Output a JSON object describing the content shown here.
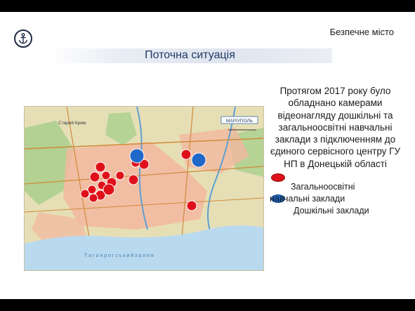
{
  "header": {
    "brand": "Безпечне місто",
    "title": "Поточна ситуація"
  },
  "logo_icon": "anchor-icon",
  "description": "Протягом 2017 року було обладнано камерами відеонагляду дошкільні та загальноосвітні навчальні заклади з підключенням до єдиного сервісного центру ГУ НП в Донецькій області",
  "legend": {
    "items": [
      {
        "label": "Загальноосвітні",
        "color": "#e0101b"
      },
      {
        "label": "навчальні  заклади",
        "color": "#1f67c8"
      },
      {
        "label": "Дошкільні заклади"
      }
    ]
  },
  "map": {
    "city_label": "МАРІУПОЛЬ",
    "sea_label": "Т а г а н р о г с ь к и й   з а л и в",
    "district_label": "Старий Крим",
    "colors": {
      "water": "#b9d9ef",
      "land": "#e6dfb6",
      "urban": "#f2b8a0",
      "green": "#a9cf8c",
      "marker_red": "#e0101b",
      "marker_blue": "#1f67c8"
    }
  }
}
